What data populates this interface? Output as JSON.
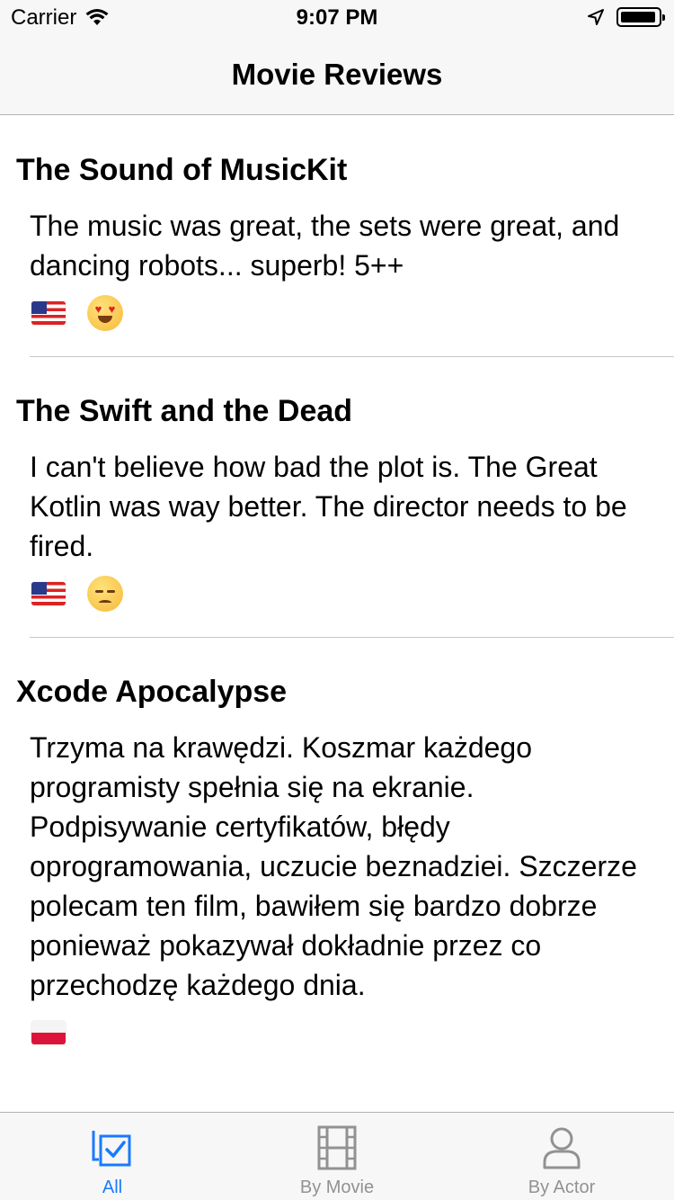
{
  "status": {
    "carrier": "Carrier",
    "time": "9:07 PM"
  },
  "nav": {
    "title": "Movie Reviews"
  },
  "reviews": [
    {
      "title": "The Sound of MusicKit",
      "body": "The music was great, the sets were great, and dancing robots... superb! 5++",
      "flag": "us-flag",
      "emoji": "heart-eyes-emoji"
    },
    {
      "title": "The Swift and the Dead",
      "body": "I can't believe how bad the plot is. The Great Kotlin was way better. The director needs to be fired.",
      "flag": "us-flag",
      "emoji": "disappointed-emoji"
    },
    {
      "title": "Xcode Apocalypse",
      "body": "Trzyma na krawędzi. Koszmar każdego programisty spełnia się na ekranie. Podpisywanie certyfikatów, błędy oprogramowania, uczucie beznadziei. Szczerze polecam ten film, bawiłem się bardzo dobrze ponieważ pokazywał dokładnie przez co przechodzę każdego dnia.",
      "flag": "pl-flag"
    }
  ],
  "tabs": [
    {
      "label": "All",
      "icon": "checklist-icon",
      "active": true
    },
    {
      "label": "By Movie",
      "icon": "film-icon",
      "active": false
    },
    {
      "label": "By Actor",
      "icon": "person-icon",
      "active": false
    }
  ],
  "colors": {
    "accent": "#1a7aff",
    "inactive": "#929292",
    "bar": "#f7f7f7"
  }
}
